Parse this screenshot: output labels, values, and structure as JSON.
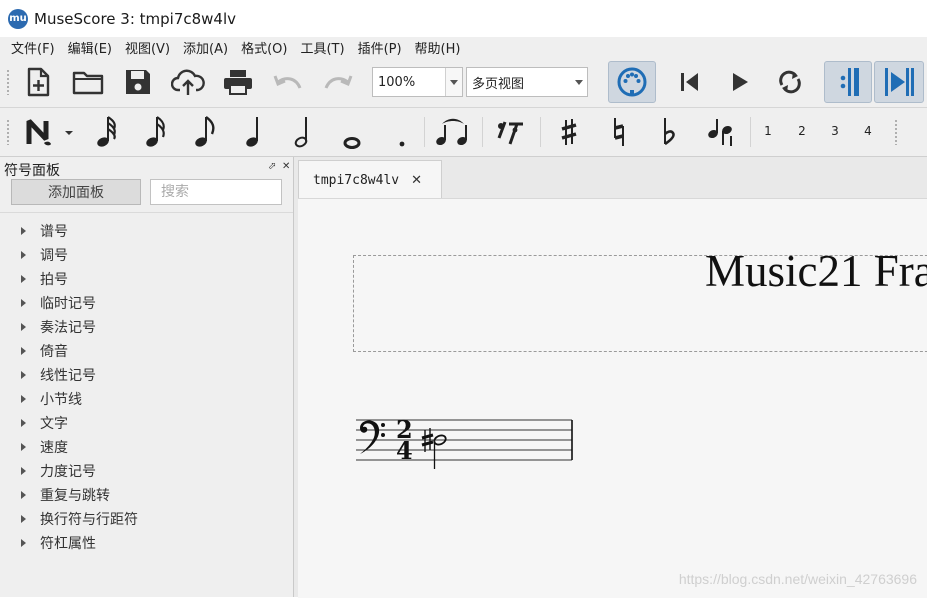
{
  "window": {
    "logo_text": "mu",
    "title": "MuseScore 3: tmpi7c8w4lv"
  },
  "menu": [
    "文件(F)",
    "编辑(E)",
    "视图(V)",
    "添加(A)",
    "格式(O)",
    "工具(T)",
    "插件(P)",
    "帮助(H)"
  ],
  "toolbar": {
    "zoom_value": "100%",
    "view_mode": "多页视图"
  },
  "note_input": {
    "voices": [
      "1",
      "2",
      "3",
      "4"
    ]
  },
  "palette": {
    "header": "符号面板",
    "add_button": "添加面板",
    "search_placeholder": "搜索",
    "items": [
      "谱号",
      "调号",
      "拍号",
      "临时记号",
      "奏法记号",
      "倚音",
      "线性记号",
      "小节线",
      "文字",
      "速度",
      "力度记号",
      "重复与跳转",
      "换行符与行距符",
      "符杠属性"
    ]
  },
  "score": {
    "tab_label": "tmpi7c8w4lv",
    "title_visible": "Music21 Fra",
    "time_signature_top": "2",
    "time_signature_bottom": "4"
  },
  "watermark": "https://blog.csdn.net/weixin_42763696",
  "colors": {
    "accent_blue": "#1f6db5",
    "toolbar_bg": "#efefef",
    "active_btn": "#cfd7e0"
  }
}
